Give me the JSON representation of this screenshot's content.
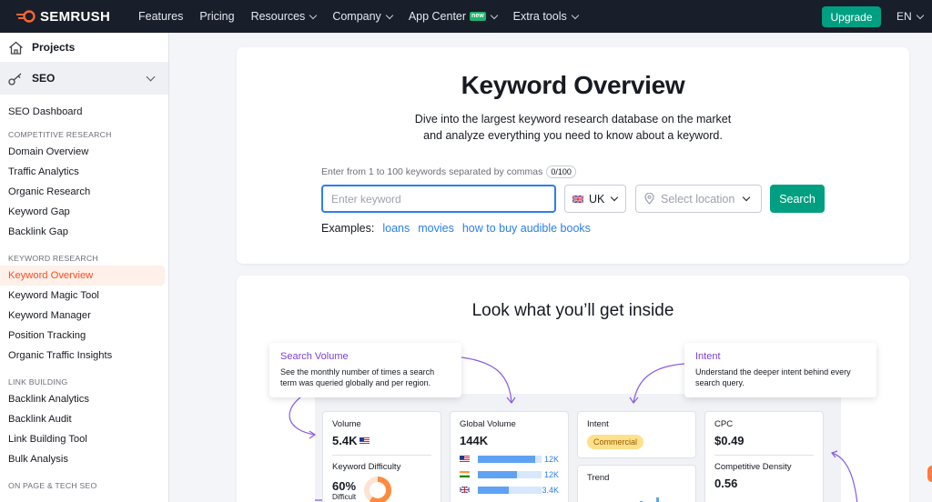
{
  "topnav": {
    "logo_text": "SEMRUSH",
    "items": [
      {
        "label": "Features",
        "dropdown": false
      },
      {
        "label": "Pricing",
        "dropdown": false
      },
      {
        "label": "Resources",
        "dropdown": true
      },
      {
        "label": "Company",
        "dropdown": true
      },
      {
        "label": "App Center",
        "dropdown": true,
        "badge": "new"
      },
      {
        "label": "Extra tools",
        "dropdown": true
      }
    ],
    "upgrade_label": "Upgrade",
    "lang_label": "EN"
  },
  "sidebar": {
    "projects_label": "Projects",
    "seo_label": "SEO",
    "dashboard_label": "SEO Dashboard",
    "sections": [
      {
        "heading": "COMPETITIVE RESEARCH",
        "items": [
          "Domain Overview",
          "Traffic Analytics",
          "Organic Research",
          "Keyword Gap",
          "Backlink Gap"
        ]
      },
      {
        "heading": "KEYWORD RESEARCH",
        "items": [
          "Keyword Overview",
          "Keyword Magic Tool",
          "Keyword Manager",
          "Position Tracking",
          "Organic Traffic Insights"
        ]
      },
      {
        "heading": "LINK BUILDING",
        "items": [
          "Backlink Analytics",
          "Backlink Audit",
          "Link Building Tool",
          "Bulk Analysis"
        ]
      },
      {
        "heading": "ON PAGE & TECH SEO",
        "items": []
      }
    ],
    "active_item": "Keyword Overview"
  },
  "keyword_overview": {
    "title": "Keyword Overview",
    "subtitle_line1": "Dive into the largest keyword research database on the market",
    "subtitle_line2": "and analyze everything you need to know about a keyword.",
    "hint": "Enter from 1 to 100 keywords separated by commas",
    "counter": "0/100",
    "input_placeholder": "Enter keyword",
    "input_value": "",
    "database": "UK",
    "location_placeholder": "Select location",
    "search_label": "Search",
    "examples_label": "Examples:",
    "examples": [
      "loans",
      "movies",
      "how to buy audible books"
    ]
  },
  "inside": {
    "title": "Look what you’ll get inside",
    "callouts": [
      {
        "title": "Search Volume",
        "desc": "See the monthly number of times a search term was queried globally and per region."
      },
      {
        "title": "Intent",
        "desc": "Understand the deeper intent behind every search query."
      }
    ],
    "volume": {
      "label": "Volume",
      "value": "5.4K"
    },
    "keyword_difficulty": {
      "label": "Keyword Difficulty",
      "value": "60%",
      "level": "Difficult",
      "percent": 60
    },
    "global_volume": {
      "label": "Global Volume",
      "value": "144K",
      "rows": [
        {
          "flag": "us",
          "value": "12K",
          "fill": 0.9
        },
        {
          "flag": "in",
          "value": "12K",
          "fill": 0.62
        },
        {
          "flag": "uk",
          "value": "3.4K",
          "fill": 0.48
        }
      ]
    },
    "intent": {
      "label": "Intent",
      "value": "Commercial"
    },
    "trend": {
      "label": "Trend"
    },
    "cpc": {
      "label": "CPC",
      "value": "$0.49"
    },
    "competitive_density": {
      "label": "Competitive Density",
      "value": "0.56"
    }
  },
  "colors": {
    "brand_orange": "#ff642d",
    "nav_bg": "#181e2a",
    "accent_green": "#009f81",
    "link_blue": "#2a7ef1",
    "callout_purple": "#7b40d8"
  }
}
